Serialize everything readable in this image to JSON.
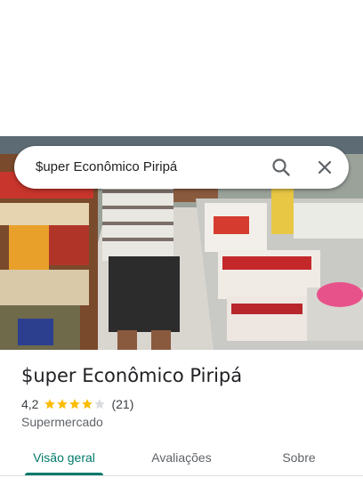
{
  "search": {
    "query": "$uper Econômico Piripá",
    "search_icon": "search-icon",
    "close_icon": "close-icon"
  },
  "place": {
    "name": "$uper Econômico Piripá",
    "rating": "4,2",
    "stars_filled": 4,
    "stars_total": 5,
    "reviews": "(21)",
    "category": "Supermercado"
  },
  "tabs": [
    {
      "label": "Visão geral",
      "active": true
    },
    {
      "label": "Avaliações",
      "active": false
    },
    {
      "label": "Sobre",
      "active": false
    }
  ],
  "colors": {
    "accent": "#00796b",
    "star": "#fbbc04",
    "star_empty": "#dadce0"
  }
}
